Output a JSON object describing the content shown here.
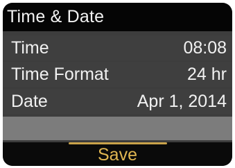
{
  "header": {
    "title": "Time & Date"
  },
  "rows": [
    {
      "label": "Time",
      "value": "08:08"
    },
    {
      "label": "Time Format",
      "value": "24 hr"
    },
    {
      "label": "Date",
      "value": "Apr 1, 2014"
    }
  ],
  "footer": {
    "save_label": "Save"
  },
  "colors": {
    "screen_bg": "#3d3d3d",
    "title_bg": "#050505",
    "empty_row_bg": "#7c7c7c",
    "text": "#f1f1f1",
    "save_accent": "#e0b651"
  }
}
